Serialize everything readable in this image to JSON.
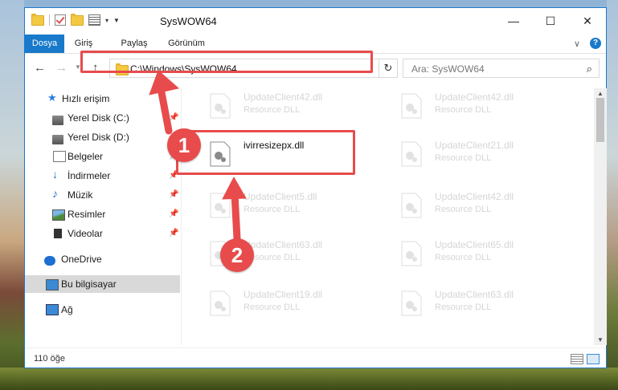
{
  "window": {
    "title": "SysWOW64",
    "controls": {
      "minimize": "—",
      "maximize": "☐",
      "close": "✕"
    }
  },
  "ribbon": {
    "tabs": [
      "Dosya",
      "Giriş",
      "Paylaş",
      "Görünüm"
    ],
    "help": "?"
  },
  "navigation": {
    "address": "C:\\Windows\\SysWOW64",
    "search_placeholder": "Ara: SysWOW64"
  },
  "sidebar": {
    "items": [
      {
        "label": "Hızlı erişim",
        "icon": "star-icon"
      },
      {
        "label": "Yerel Disk (C:)",
        "icon": "disk-icon",
        "pinned": true
      },
      {
        "label": "Yerel Disk (D:)",
        "icon": "disk-icon",
        "pinned": true
      },
      {
        "label": "Belgeler",
        "icon": "documents-icon",
        "pinned": true
      },
      {
        "label": "İndirmeler",
        "icon": "downloads-icon",
        "pinned": true
      },
      {
        "label": "Müzik",
        "icon": "music-icon",
        "pinned": true
      },
      {
        "label": "Resimler",
        "icon": "pictures-icon",
        "pinned": true
      },
      {
        "label": "Videolar",
        "icon": "videos-icon",
        "pinned": true
      },
      {
        "label": "OneDrive",
        "icon": "cloud-icon"
      },
      {
        "label": "Bu bilgisayar",
        "icon": "computer-icon",
        "selected": true
      },
      {
        "label": "Ağ",
        "icon": "network-icon"
      }
    ]
  },
  "files": [
    {
      "name": "UpdateClient42.dll",
      "desc": "Resource DLL"
    },
    {
      "name": "UpdateClient42.dll",
      "desc": "Resource DLL"
    },
    {
      "name": "ivirresizepx.dll",
      "desc": ""
    },
    {
      "name": "UpdateClient21.dll",
      "desc": "Resource DLL"
    },
    {
      "name": "UpdateClient5.dll",
      "desc": "Resource DLL"
    },
    {
      "name": "UpdateClient42.dll",
      "desc": "Resource DLL"
    },
    {
      "name": "UpdateClient63.dll",
      "desc": "Resource DLL"
    },
    {
      "name": "UpdateClient65.dll",
      "desc": "Resource DLL"
    },
    {
      "name": "UpdateClient19.dll",
      "desc": "Resource DLL"
    },
    {
      "name": "UpdateClient63.dll",
      "desc": "Resource DLL"
    }
  ],
  "status": {
    "count": "110 öğe"
  },
  "annotations": {
    "step1": "1",
    "step2": "2",
    "color": "#e84b4b"
  }
}
